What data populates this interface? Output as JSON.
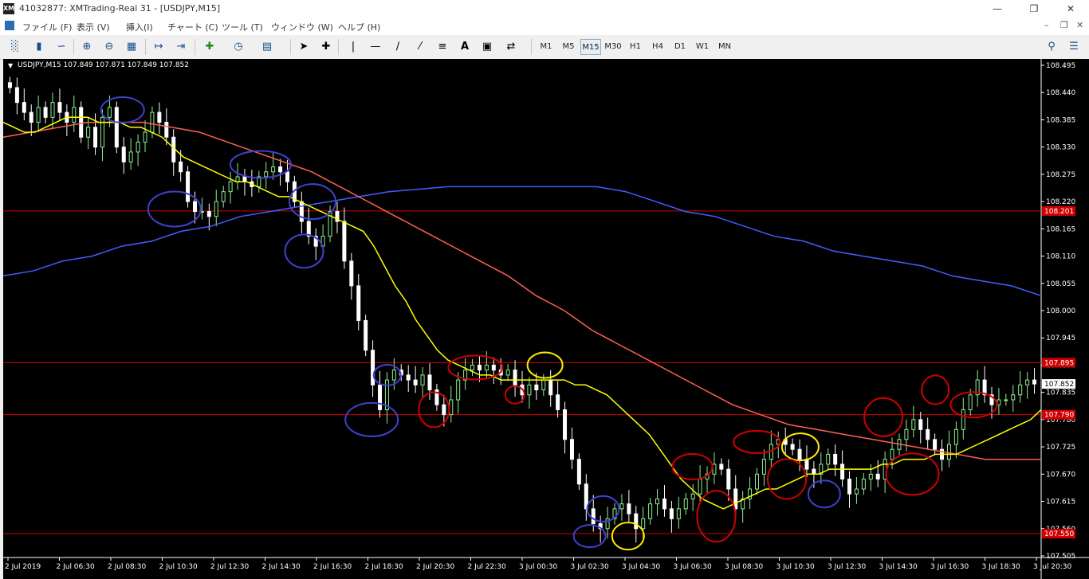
{
  "window": {
    "title": "41032877: XMTrading-Real 31 - [USDJPY,M15]",
    "logo": "XM",
    "buttons": [
      "minimize-icon",
      "restore-icon",
      "close-icon"
    ]
  },
  "menu": [
    "ファイル (F)",
    "表示 (V)",
    "挿入(I)",
    "チャート (C)",
    "ツール (T)",
    "ウィンドウ (W)",
    "ヘルプ (H)"
  ],
  "timeframes": [
    "M1",
    "M5",
    "M15",
    "M30",
    "H1",
    "H4",
    "D1",
    "W1",
    "MN"
  ],
  "active_timeframe": "M15",
  "symbol_info": "USDJPY,M15  107.849 107.871 107.849 107.852",
  "chart_data": {
    "type": "candlestick",
    "symbol": "USDJPY",
    "timeframe": "M15",
    "ylim": [
      107.505,
      108.495
    ],
    "y_ticks": [
      108.495,
      108.44,
      108.385,
      108.33,
      108.275,
      108.22,
      108.165,
      108.11,
      108.055,
      108.0,
      107.945,
      107.89,
      107.835,
      107.78,
      107.725,
      107.67,
      107.615,
      107.56,
      107.505
    ],
    "x_labels": [
      "2 Jul 2019",
      "2 Jul 06:30",
      "2 Jul 08:30",
      "2 Jul 10:30",
      "2 Jul 12:30",
      "2 Jul 14:30",
      "2 Jul 16:30",
      "2 Jul 18:30",
      "2 Jul 20:30",
      "2 Jul 22:30",
      "3 Jul 00:30",
      "3 Jul 02:30",
      "3 Jul 04:30",
      "3 Jul 06:30",
      "3 Jul 08:30",
      "3 Jul 10:30",
      "3 Jul 12:30",
      "3 Jul 14:30",
      "3 Jul 16:30",
      "3 Jul 18:30",
      "3 Jul 20:30"
    ],
    "current_price": 107.852,
    "h_lines": [
      {
        "price": 108.201,
        "label": "108.201",
        "color": "#d00000"
      },
      {
        "price": 107.895,
        "label": "107.895",
        "color": "#d00000"
      },
      {
        "price": 107.79,
        "label": "107.790",
        "color": "#d00000"
      },
      {
        "price": 107.55,
        "label": "107.550",
        "color": "#d00000"
      }
    ],
    "close": [
      108.45,
      108.42,
      108.4,
      108.38,
      108.41,
      108.39,
      108.42,
      108.4,
      108.38,
      108.41,
      108.35,
      108.37,
      108.33,
      108.39,
      108.41,
      108.33,
      108.3,
      108.32,
      108.34,
      108.36,
      108.4,
      108.38,
      108.35,
      108.3,
      108.28,
      108.22,
      108.2,
      108.2,
      108.19,
      108.22,
      108.24,
      108.26,
      108.27,
      108.26,
      108.25,
      108.27,
      108.28,
      108.29,
      108.28,
      108.26,
      108.22,
      108.18,
      108.15,
      108.13,
      108.15,
      108.2,
      108.18,
      108.1,
      108.05,
      107.98,
      107.92,
      107.85,
      107.8,
      107.86,
      107.88,
      107.87,
      107.86,
      107.85,
      107.87,
      107.84,
      107.81,
      107.79,
      107.82,
      107.86,
      107.88,
      107.89,
      107.88,
      107.89,
      107.88,
      107.87,
      107.88,
      107.85,
      107.83,
      107.85,
      107.84,
      107.86,
      107.83,
      107.8,
      107.74,
      107.7,
      107.65,
      107.6,
      107.57,
      107.56,
      107.58,
      107.6,
      107.61,
      107.59,
      107.56,
      107.58,
      107.61,
      107.62,
      107.6,
      107.58,
      107.6,
      107.62,
      107.63,
      107.66,
      107.67,
      107.69,
      107.68,
      107.64,
      107.6,
      107.62,
      107.64,
      107.67,
      107.7,
      107.73,
      107.74,
      107.73,
      107.72,
      107.7,
      107.68,
      107.67,
      107.69,
      107.71,
      107.69,
      107.66,
      107.63,
      107.64,
      107.66,
      107.67,
      107.66,
      107.7,
      107.72,
      107.74,
      107.76,
      107.78,
      107.76,
      107.74,
      107.72,
      107.7,
      107.73,
      107.76,
      107.8,
      107.83,
      107.86,
      107.83,
      107.81,
      107.82,
      107.82,
      107.83,
      107.85,
      107.86,
      107.852
    ],
    "ma_fast": [
      108.38,
      108.37,
      108.36,
      108.36,
      108.37,
      108.38,
      108.39,
      108.39,
      108.39,
      108.38,
      108.38,
      108.38,
      108.37,
      108.37,
      108.36,
      108.35,
      108.33,
      108.31,
      108.3,
      108.29,
      108.28,
      108.27,
      108.26,
      108.26,
      108.25,
      108.24,
      108.23,
      108.23,
      108.22,
      108.21,
      108.2,
      108.19,
      108.18,
      108.17,
      108.16,
      108.13,
      108.09,
      108.05,
      108.02,
      107.98,
      107.95,
      107.92,
      107.9,
      107.89,
      107.88,
      107.87,
      107.87,
      107.86,
      107.86,
      107.86,
      107.86,
      107.86,
      107.86,
      107.86,
      107.85,
      107.85,
      107.84,
      107.83,
      107.81,
      107.79,
      107.77,
      107.75,
      107.72,
      107.69,
      107.66,
      107.64,
      107.62,
      107.61,
      107.6,
      107.61,
      107.62,
      107.63,
      107.64,
      107.64,
      107.65,
      107.66,
      107.67,
      107.67,
      107.68,
      107.68,
      107.68,
      107.68,
      107.68,
      107.69,
      107.69,
      107.7,
      107.7,
      107.7,
      107.71,
      107.71,
      107.71,
      107.72,
      107.73,
      107.74,
      107.75,
      107.76,
      107.77,
      107.78,
      107.8
    ],
    "ma_mid": [
      108.35,
      108.36,
      108.37,
      108.38,
      108.38,
      108.38,
      108.37,
      108.36,
      108.34,
      108.32,
      108.3,
      108.28,
      108.25,
      108.22,
      108.19,
      108.16,
      108.13,
      108.1,
      108.07,
      108.03,
      108.0,
      107.96,
      107.93,
      107.9,
      107.87,
      107.84,
      107.81,
      107.79,
      107.77,
      107.76,
      107.75,
      107.74,
      107.73,
      107.72,
      107.71,
      107.7,
      107.7,
      107.7
    ],
    "ma_slow": [
      108.07,
      108.08,
      108.1,
      108.11,
      108.13,
      108.14,
      108.16,
      108.17,
      108.19,
      108.2,
      108.21,
      108.22,
      108.23,
      108.24,
      108.245,
      108.25,
      108.25,
      108.25,
      108.25,
      108.25,
      108.25,
      108.24,
      108.22,
      108.2,
      108.19,
      108.17,
      108.15,
      108.14,
      108.12,
      108.11,
      108.1,
      108.09,
      108.07,
      108.06,
      108.05,
      108.03
    ],
    "colors": {
      "bull": "#8ff08f",
      "bear": "#ffffff",
      "ma_fast": "#ffff00",
      "ma_mid": "#ff6050",
      "ma_slow": "#4060ff",
      "grid_text": "#ffffff"
    },
    "annotations": [
      {
        "color": "#4040d0",
        "t": 0.115,
        "p": 108.405,
        "rx": 27,
        "ry": 16
      },
      {
        "color": "#4040d0",
        "t": 0.165,
        "p": 108.205,
        "rx": 33,
        "ry": 22
      },
      {
        "color": "#4040d0",
        "t": 0.248,
        "p": 108.295,
        "rx": 38,
        "ry": 17
      },
      {
        "color": "#4040d0",
        "t": 0.298,
        "p": 108.22,
        "rx": 29,
        "ry": 22
      },
      {
        "color": "#4040d0",
        "t": 0.29,
        "p": 108.12,
        "rx": 24,
        "ry": 21
      },
      {
        "color": "#4040d0",
        "t": 0.37,
        "p": 107.87,
        "rx": 17,
        "ry": 13
      },
      {
        "color": "#4040d0",
        "t": 0.355,
        "p": 107.78,
        "rx": 33,
        "ry": 21
      },
      {
        "color": "#d00000",
        "t": 0.415,
        "p": 107.8,
        "rx": 19,
        "ry": 22
      },
      {
        "color": "#d00000",
        "t": 0.455,
        "p": 107.885,
        "rx": 34,
        "ry": 15
      },
      {
        "color": "#ffee00",
        "t": 0.522,
        "p": 107.89,
        "rx": 22,
        "ry": 16
      },
      {
        "color": "#d00000",
        "t": 0.493,
        "p": 107.83,
        "rx": 12,
        "ry": 11
      },
      {
        "color": "#4040d0",
        "t": 0.578,
        "p": 107.6,
        "rx": 20,
        "ry": 16
      },
      {
        "color": "#4040d0",
        "t": 0.565,
        "p": 107.545,
        "rx": 20,
        "ry": 14
      },
      {
        "color": "#ffee00",
        "t": 0.602,
        "p": 107.545,
        "rx": 20,
        "ry": 17
      },
      {
        "color": "#d00000",
        "t": 0.664,
        "p": 107.685,
        "rx": 25,
        "ry": 16
      },
      {
        "color": "#d00000",
        "t": 0.687,
        "p": 107.585,
        "rx": 24,
        "ry": 32
      },
      {
        "color": "#d00000",
        "t": 0.726,
        "p": 107.735,
        "rx": 29,
        "ry": 14
      },
      {
        "color": "#ffee00",
        "t": 0.768,
        "p": 107.725,
        "rx": 23,
        "ry": 17
      },
      {
        "color": "#d00000",
        "t": 0.755,
        "p": 107.66,
        "rx": 24,
        "ry": 25
      },
      {
        "color": "#4040d0",
        "t": 0.791,
        "p": 107.63,
        "rx": 20,
        "ry": 17
      },
      {
        "color": "#d00000",
        "t": 0.848,
        "p": 107.785,
        "rx": 24,
        "ry": 24
      },
      {
        "color": "#d00000",
        "t": 0.876,
        "p": 107.67,
        "rx": 33,
        "ry": 26
      },
      {
        "color": "#d00000",
        "t": 0.898,
        "p": 107.84,
        "rx": 17,
        "ry": 18
      },
      {
        "color": "#d00000",
        "t": 0.935,
        "p": 107.81,
        "rx": 29,
        "ry": 16
      }
    ]
  }
}
